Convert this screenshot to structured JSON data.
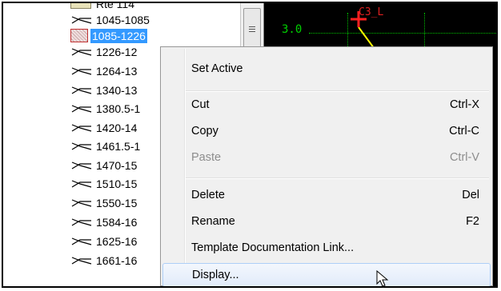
{
  "tree": {
    "items": [
      {
        "label": "Rte 114",
        "icon": "folder-icon",
        "selected": false
      },
      {
        "label": "1045-1085",
        "icon": "cross-section-icon",
        "selected": false
      },
      {
        "label": "1085-1226",
        "icon": "hatched-cross-section-icon",
        "selected": true
      },
      {
        "label": "1226-12",
        "icon": "cross-section-icon",
        "selected": false
      },
      {
        "label": "1264-13",
        "icon": "cross-section-icon",
        "selected": false
      },
      {
        "label": "1340-13",
        "icon": "cross-section-icon",
        "selected": false
      },
      {
        "label": "1380.5-1",
        "icon": "cross-section-icon",
        "selected": false
      },
      {
        "label": "1420-14",
        "icon": "cross-section-icon",
        "selected": false
      },
      {
        "label": "1461.5-1",
        "icon": "cross-section-icon",
        "selected": false
      },
      {
        "label": "1470-15",
        "icon": "cross-section-icon",
        "selected": false
      },
      {
        "label": "1510-15",
        "icon": "cross-section-icon",
        "selected": false
      },
      {
        "label": "1550-15",
        "icon": "cross-section-icon",
        "selected": false
      },
      {
        "label": "1584-16",
        "icon": "cross-section-icon",
        "selected": false
      },
      {
        "label": "1625-16",
        "icon": "cross-section-icon",
        "selected": false
      },
      {
        "label": "1661-16",
        "icon": "cross-section-icon",
        "selected": false
      }
    ]
  },
  "plot": {
    "y_label": "3.0",
    "point_label": "C3_L",
    "colors": {
      "background": "#000000",
      "grid": "#00c000",
      "point": "#e02020",
      "line": "#ffff00"
    }
  },
  "menu": {
    "set_active": "Set Active",
    "cut": {
      "label": "Cut",
      "shortcut": "Ctrl-X"
    },
    "copy": {
      "label": "Copy",
      "shortcut": "Ctrl-C"
    },
    "paste": {
      "label": "Paste",
      "shortcut": "Ctrl-V",
      "disabled": true
    },
    "delete": {
      "label": "Delete",
      "shortcut": "Del"
    },
    "rename": {
      "label": "Rename",
      "shortcut": "F2"
    },
    "template_doc": "Template Documentation Link...",
    "display": {
      "label": "Display...",
      "hovered": true
    }
  }
}
